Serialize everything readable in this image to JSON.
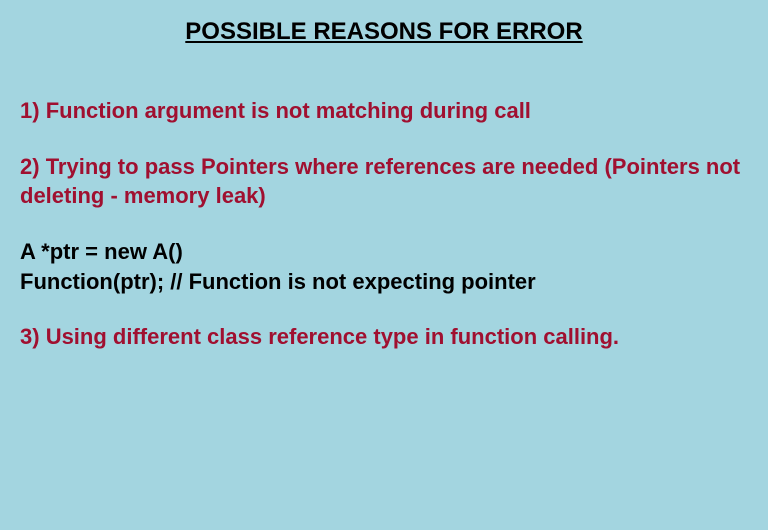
{
  "title": "POSSIBLE REASONS FOR ERROR",
  "items": [
    {
      "num": "1)",
      "text": "Function argument is not matching during call"
    },
    {
      "num": "2)",
      "text": "Trying to pass Pointers where references are needed (Pointers not deleting - memory leak)"
    },
    {
      "num": "3)",
      "text": "Using different class reference type in function calling."
    }
  ],
  "code": {
    "line1": "A *ptr = new A()",
    "line2": "Function(ptr); // Function is not expecting pointer"
  }
}
